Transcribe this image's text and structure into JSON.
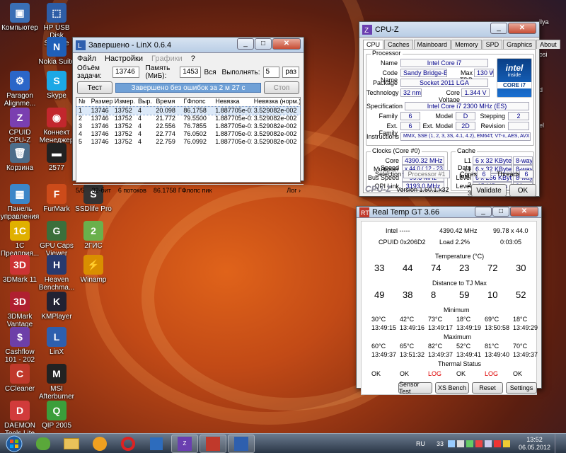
{
  "desktop": {
    "icons": [
      {
        "label": "Компьютер",
        "color": "#3a6fb5",
        "glyph": "▣"
      },
      {
        "label": "HP USB Disk Storage Fo...",
        "color": "#2d5da6",
        "glyph": "⬚"
      },
      {
        "label": "Nokia Suite",
        "color": "#1f5fb8",
        "glyph": "N"
      },
      {
        "label": "Paragon Alignme...",
        "color": "#2b66c8",
        "glyph": "⚙"
      },
      {
        "label": "Skype",
        "color": "#1ca8e6",
        "glyph": "S"
      },
      {
        "label": "CPUID CPU-Z",
        "color": "#7a3fb0",
        "glyph": "Z"
      },
      {
        "label": "Коннект Менеджер",
        "color": "#c2272d",
        "glyph": "◉"
      },
      {
        "label": "Корзина",
        "color": "#4d6d8a",
        "glyph": "🗑"
      },
      {
        "label": "2577",
        "color": "#222222",
        "glyph": "▬"
      },
      {
        "label": "Панель управления",
        "color": "#3c86c8",
        "glyph": "▦"
      },
      {
        "label": "FurMark",
        "color": "#cc4b1a",
        "glyph": "F"
      },
      {
        "label": "SSDlife Pro",
        "color": "#333333",
        "glyph": "S"
      },
      {
        "label": "1С Предприя...",
        "color": "#e0b000",
        "glyph": "1С"
      },
      {
        "label": "GPU Caps Viewer",
        "color": "#3b6f3b",
        "glyph": "G"
      },
      {
        "label": "2ГИС",
        "color": "#6ab04c",
        "glyph": "2"
      },
      {
        "label": "3DMark 11",
        "color": "#c33",
        "glyph": "3D"
      },
      {
        "label": "Heaven Benchma...",
        "color": "#283a6e",
        "glyph": "H"
      },
      {
        "label": "Winamp",
        "color": "#d98f00",
        "glyph": "⚡"
      },
      {
        "label": "3DMark Vantage",
        "color": "#b02030",
        "glyph": "3D"
      },
      {
        "label": "KMPlayer",
        "color": "#223",
        "glyph": "K"
      },
      {
        "label": "Cashflow 101 - 202",
        "color": "#6d3fa8",
        "glyph": "$"
      },
      {
        "label": "LinX",
        "color": "#2e5fae",
        "glyph": "L"
      },
      {
        "label": "CCleaner",
        "color": "#c0392b",
        "glyph": "C"
      },
      {
        "label": "MSI Afterburner",
        "color": "#222",
        "glyph": "M"
      },
      {
        "label": "DAEMON Tools Lite",
        "color": "#d13b3b",
        "glyph": "D"
      },
      {
        "label": "QIP 2005",
        "color": "#3b9e3b",
        "glyph": "Q"
      }
    ],
    "right_edge_labels": [
      "ilya",
      "osi",
      "d",
      "el",
      "ee",
      "p"
    ]
  },
  "linx": {
    "title": "Завершено - LinX 0.6.4",
    "menu": [
      "Файл",
      "Настройки",
      "Графики",
      "?"
    ],
    "problem_label": "Объём задачи:",
    "problem_value": "13746",
    "memory_label": "Память (МиБ):",
    "memory_value": "1453",
    "all_label": "Вся",
    "run_label": "Выполнять:",
    "run_value": "5",
    "run_unit": "раз",
    "test_button": "Тест",
    "progress_text": "Завершено без ошибок за 2 м 27 с",
    "progress_percent": 100,
    "stop_button": "Стоп",
    "columns": [
      "№",
      "Размер",
      "Измер.",
      "Выр.",
      "Время",
      "ГФлопс",
      "Невязка",
      "Невязка (норм.)"
    ],
    "rows": [
      [
        "1",
        "13746",
        "13752",
        "4",
        "20.098",
        "86.1758",
        "1.887705e-010",
        "3.529082e-002"
      ],
      [
        "2",
        "13746",
        "13752",
        "4",
        "21.772",
        "79.5500",
        "1.887705e-010",
        "3.529082e-002"
      ],
      [
        "3",
        "13746",
        "13752",
        "4",
        "22.556",
        "76.7855",
        "1.887705e-010",
        "3.529082e-002"
      ],
      [
        "4",
        "13746",
        "13752",
        "4",
        "22.774",
        "76.0502",
        "1.887705e-010",
        "3.529082e-002"
      ],
      [
        "5",
        "13746",
        "13752",
        "4",
        "22.759",
        "76.0992",
        "1.887705e-010",
        "3.529082e-002"
      ]
    ],
    "status": [
      "5/5",
      "32-бит",
      "6 потоков",
      "86.1758 ГФлопс пик"
    ],
    "log_button": "Лог ›"
  },
  "cpuz": {
    "title": "CPU-Z",
    "tabs": [
      "CPU",
      "Caches",
      "Mainboard",
      "Memory",
      "SPD",
      "Graphics",
      "About"
    ],
    "processor_group": "Processor",
    "name_label": "Name",
    "name": "Intel Core i7",
    "codename_label": "Code Name",
    "codename": "Sandy Bridge-E",
    "tdp_label": "Max TDP",
    "tdp": "130 W",
    "package_label": "Package",
    "package": "Socket 2011 LGA",
    "tech_label": "Technology",
    "tech": "32 nm",
    "voltage_label": "Core Voltage",
    "voltage": "1.344 V",
    "spec_label": "Specification",
    "spec": "Intel Core i7 2300 MHz (ES)",
    "family_label": "Family",
    "family": "6",
    "model_label": "Model",
    "model": "D",
    "stepping_label": "Stepping",
    "stepping": "2",
    "extfamily_label": "Ext. Family",
    "extfamily": "6",
    "extmodel_label": "Ext. Model",
    "extmodel": "2D",
    "revision_label": "Revision",
    "revision": "",
    "instr_label": "Instructions",
    "instr": "MMX, SSE (1, 2, 3, 3S, 4.1, 4.2), EM64T, VT-x, AES, AVX",
    "clocks_group": "Clocks (Core #0)",
    "corespeed_label": "Core Speed",
    "corespeed": "4390.32 MHz",
    "mult_label": "Multiplier",
    "mult": "x 44.0 ( 12 - 23 )",
    "bus_label": "Bus Speed",
    "bus": "99.8 MHz",
    "qpi_label": "QPI Link",
    "qpi": "3193.0 MHz",
    "cache_group": "Cache",
    "l1d_label": "L1 Data",
    "l1d": "6 x 32 KBytes",
    "l1d_way": "8-way",
    "l1i_label": "L1 Inst.",
    "l1i": "6 x 32 KBytes",
    "l1i_way": "8-way",
    "l2_label": "Level 2",
    "l2": "6 x 256 KBytes",
    "l2_way": "8-way",
    "l3_label": "Level 3",
    "l3": "15 MBytes",
    "l3_way": "20-way",
    "selection_label": "Selection",
    "selection": "Processor #1",
    "cores_label": "Cores",
    "cores": "6",
    "threads_label": "Threads",
    "threads": "6",
    "logo": "CPU-Z",
    "version": "Version 1.60.1.x32",
    "validate_button": "Validate",
    "ok_button": "OK",
    "intel_badge_top": "intel",
    "intel_badge_inside": "inside",
    "intel_badge_core": "CORE i7"
  },
  "realtemp": {
    "title": "Real Temp GT 3.66",
    "cpu_name": "Intel -----",
    "freq": "4390.42 MHz",
    "bclk": "99.78 x 44.0",
    "cpuid": "CPUID  0x206D2",
    "load": "Load  2.2%",
    "uptime": "0:03:05",
    "temp_label": "Temperature (°C)",
    "temps": [
      "33",
      "44",
      "74",
      "23",
      "72",
      "30"
    ],
    "tj_label": "Distance to TJ Max",
    "distances": [
      "49",
      "38",
      "8",
      "59",
      "10",
      "52"
    ],
    "min_label": "Minimum",
    "min_temps": [
      "30°C",
      "42°C",
      "73°C",
      "18°C",
      "69°C",
      "18°C"
    ],
    "min_times": [
      "13:49:15",
      "13:49:16",
      "13:49:17",
      "13:49:19",
      "13:50:58",
      "13:49:29"
    ],
    "max_label": "Maximum",
    "max_temps": [
      "60°C",
      "65°C",
      "82°C",
      "52°C",
      "81°C",
      "70°C"
    ],
    "max_times": [
      "13:49:37",
      "13:51:32",
      "13:49:37",
      "13:49:41",
      "13:49:40",
      "13:49:37"
    ],
    "thermal_label": "Thermal Status",
    "status": [
      "OK",
      "OK",
      "LOG",
      "OK",
      "LOG",
      "OK"
    ],
    "buttons": [
      "Sensor Test",
      "XS Bench",
      "Reset",
      "Settings"
    ]
  },
  "taskbar": {
    "lang": "RU",
    "tray_num": "33",
    "time": "13:52",
    "date": "06.05.2012"
  }
}
